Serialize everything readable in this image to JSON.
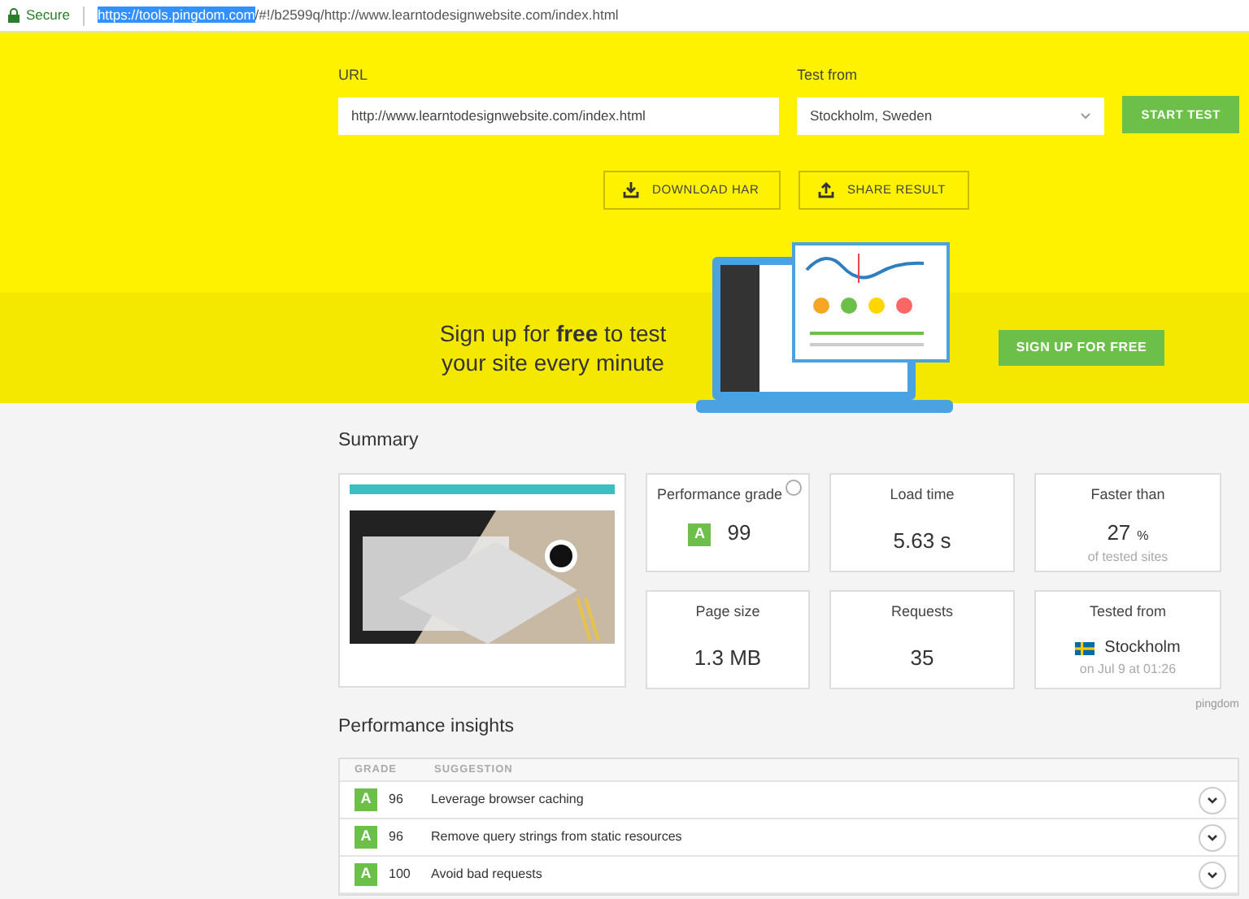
{
  "address_bar": {
    "security_label": "Secure",
    "url_highlighted": "https://tools.pingdom.com",
    "url_rest": "/#!/b2599q/http://www.learntodesignwebsite.com/index.html"
  },
  "test_form": {
    "url_label": "URL",
    "url_value": "http://www.learntodesignwebsite.com/index.html",
    "location_label": "Test from",
    "location_value": "Stockholm, Sweden",
    "start_button": "START TEST"
  },
  "actions": [
    {
      "kind": "download",
      "label": "DOWNLOAD HAR"
    },
    {
      "kind": "share",
      "label": "SHARE RESULT"
    }
  ],
  "promo": {
    "text": "Sign up for **free** to test your site every minute",
    "button": "SIGN UP FOR FREE"
  },
  "summary": {
    "title": "Summary",
    "cards": [
      {
        "kind": "grade",
        "title": "Performance grade",
        "grade": "A",
        "value": "99"
      },
      {
        "kind": "value",
        "title": "Load time",
        "value": "5.63 s"
      },
      {
        "kind": "percent",
        "title": "Faster than",
        "value": "27",
        "unit": "%",
        "note": "of tested sites"
      },
      {
        "kind": "value",
        "title": "Page size",
        "value": "1.3 MB"
      },
      {
        "kind": "value",
        "title": "Requests",
        "value": "35"
      },
      {
        "kind": "location",
        "title": "Tested from",
        "value": "Stockholm",
        "note": "on Jul 9 at 01:26"
      }
    ],
    "brand": "pingdom"
  },
  "insights": {
    "title": "Performance insights",
    "columns": [
      "GRADE",
      "SUGGESTION"
    ],
    "rows": [
      {
        "grade": "A",
        "score": "96",
        "suggestion": "Leverage browser caching"
      },
      {
        "grade": "A",
        "score": "96",
        "suggestion": "Remove query strings from static resources"
      },
      {
        "grade": "A",
        "score": "100",
        "suggestion": "Avoid bad requests"
      }
    ]
  }
}
